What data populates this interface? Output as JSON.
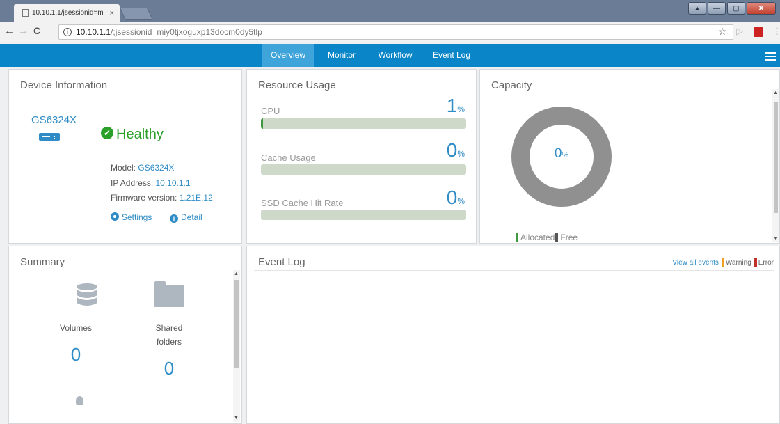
{
  "browser": {
    "tab_title": "10.10.1.1/jsessionid=m",
    "tab_close": "×",
    "window_title": "",
    "url_host": "10.10.1.1",
    "url_path": "/;jsessionid=miy0tjxoguxp13docm0dy5tlp",
    "nav_icons": [
      "back-arrow-icon",
      "forward-arrow-icon",
      "reload-icon",
      "info-icon",
      "star-icon",
      "extension-icon",
      "pdf-icon",
      "menu-dots-icon"
    ]
  },
  "nav": {
    "tabs": [
      {
        "label": "Overview",
        "active": true
      },
      {
        "label": "Monitor",
        "active": false
      },
      {
        "label": "Workflow",
        "active": false
      },
      {
        "label": "Event Log",
        "active": false
      }
    ]
  },
  "device": {
    "title": "Device Information",
    "name": "GS6324X",
    "status": "Healthy",
    "model_label": "Model:",
    "model": "GS6324X",
    "ip_label": "IP Address:",
    "ip": "10.10.1.1",
    "firmware_label": "Firmware version:",
    "firmware": "1.21E.12",
    "settings_link": "Settings",
    "detail_link": "Detail"
  },
  "resource": {
    "title": "Resource Usage",
    "items": [
      {
        "label": "CPU",
        "value": "1",
        "unit": "%",
        "percent": 1
      },
      {
        "label": "Cache Usage",
        "value": "0",
        "unit": "%",
        "percent": 0
      },
      {
        "label": "SSD Cache Hit Rate",
        "value": "0",
        "unit": "%",
        "percent": 0
      }
    ]
  },
  "capacity": {
    "title": "Capacity",
    "value": "0",
    "unit": "%",
    "percent_allocated": 0,
    "legend_allocated": "Allocated",
    "legend_free": "Free"
  },
  "summary": {
    "title": "Summary",
    "volumes_label": "Volumes",
    "volumes_value": "0",
    "shared_label_1": "Shared",
    "shared_label_2": "folders",
    "shared_value": "0"
  },
  "eventlog": {
    "title": "Event Log",
    "view_all": "View all events",
    "warning": "Warning",
    "error": "Error"
  },
  "colors": {
    "nav_blue": "#0a86c8",
    "accent_blue": "#2f8cc6",
    "healthy_green": "#2aa02a",
    "allocated_green": "#3e9a3e",
    "free_gray": "#909090",
    "warning": "#f0a020",
    "error": "#c0302a"
  }
}
